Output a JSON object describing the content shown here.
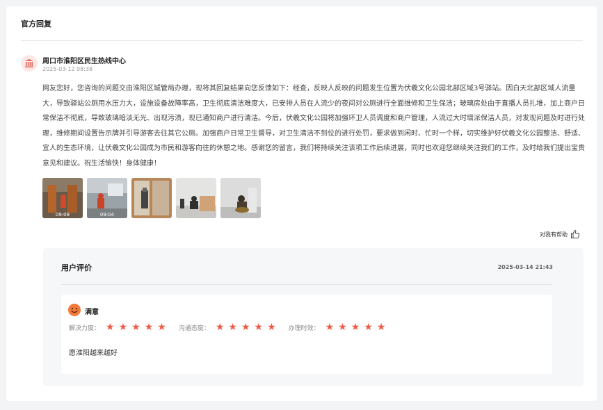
{
  "section_title": "官方回复",
  "reply": {
    "department": "周口市淮阳区民生热线中心",
    "time": "2025-03-12 08:38",
    "content": "网友您好，您咨询的问题交由淮阳区城管局办理，现将其回复结果向您反馈如下：经查，反映人反映的问题发生位置为伏羲文化公园北部区域3号驿站。因白天北部区域人流量大，导致驿站公厕用水压力大，设施设备故障率高，卫生彻底清洁难度大，已安排人员在人流少的夜间对公厕进行全面维修和卫生保洁；玻璃房处由于直播人员扎堆，加上商户日常保洁不彻底，导致玻璃暗淡无光、出现污渍，现已通知商户进行清洁。今后，伏羲文化公园将加强环卫人员调度和商户管理，人流过大时增派保洁人员，对发现问题及时进行处理，维修期间设置告示牌并引导游客去往其它公厕。加强商户日常卫生督导，对卫生清洁不到位的进行处罚，要求做到闲时、忙时一个样，切实维护好伏羲文化公园整洁、舒适、宜人的生态环境，让伏羲文化公园成为市民和游客向往的休憩之地。感谢您的留言，我们将持续关注该项工作后续进展，同时也欢迎您继续关注我们的工作，及时给我们提出宝贵意见和建议。祝生活愉快！身体健康！",
    "attachments": [
      {
        "type": "video",
        "duration": "09:08"
      },
      {
        "type": "video",
        "duration": "09:04"
      },
      {
        "type": "image",
        "duration": ""
      },
      {
        "type": "image",
        "duration": ""
      },
      {
        "type": "image",
        "duration": ""
      }
    ],
    "helpful_label": "对我有帮助"
  },
  "evaluation": {
    "title": "用户评价",
    "time": "2025-03-14 21:43",
    "satisfaction": "满意",
    "ratings": [
      {
        "label": "解决力度：",
        "stars": 5
      },
      {
        "label": "沟通态度：",
        "stars": 5
      },
      {
        "label": "办理时效：",
        "stars": 5
      }
    ],
    "comment": "愿淮阳越来越好"
  },
  "colors": {
    "star": "#f05a45",
    "face": "#f57a3a",
    "avatar_bg": "#fde8e6",
    "avatar_icon": "#e0675a"
  }
}
